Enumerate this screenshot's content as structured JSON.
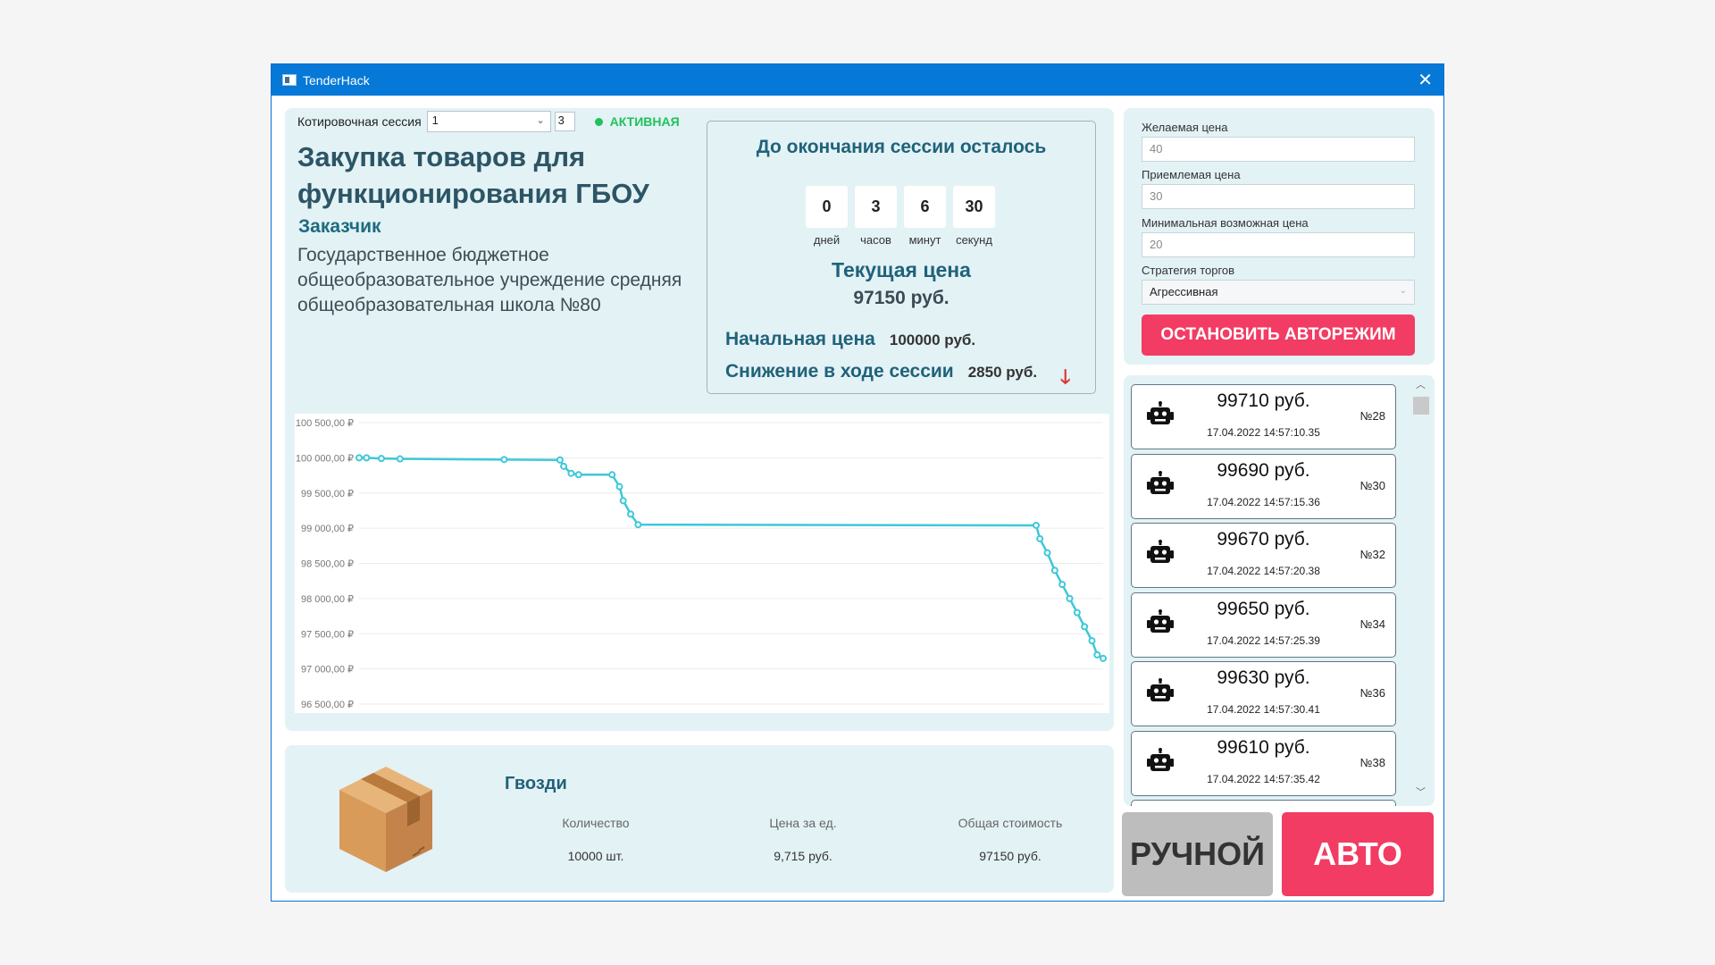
{
  "window": {
    "title": "TenderHack"
  },
  "session": {
    "label": "Котировочная сессия",
    "selected": "1",
    "number_field": "3",
    "status": "АКТИВНАЯ"
  },
  "purchase": {
    "title": "Закупка товаров для функционирования ГБОУ",
    "customer_label": "Заказчик",
    "customer_name": "Государственное бюджетное общеобразовательное учреждение средняя общеобразовательная школа №80"
  },
  "timer": {
    "title": "До окончания сессии осталось",
    "units": [
      {
        "value": "0",
        "label": "дней"
      },
      {
        "value": "3",
        "label": "часов"
      },
      {
        "value": "6",
        "label": "минут"
      },
      {
        "value": "30",
        "label": "секунд"
      }
    ],
    "current_price_label": "Текущая цена",
    "current_price": "97150 руб.",
    "start_price_label": "Начальная цена",
    "start_price": "100000 руб.",
    "decrease_label": "Снижение в ходе сессии",
    "decrease": "2850 руб."
  },
  "chart_data": {
    "type": "line",
    "y_ticks": [
      "100 500,00 ₽",
      "100 000,00 ₽",
      "99 500,00 ₽",
      "99 000,00 ₽",
      "98 500,00 ₽",
      "98 000,00 ₽",
      "97 500,00 ₽",
      "97 000,00 ₽",
      "96 500,00 ₽"
    ],
    "ylim": [
      96500,
      100500
    ],
    "xlim": [
      0,
      100
    ],
    "grid": true,
    "color": "#3ec8d8",
    "points": [
      {
        "x": 0,
        "y": 100000
      },
      {
        "x": 1,
        "y": 100000
      },
      {
        "x": 3,
        "y": 99990
      },
      {
        "x": 5.5,
        "y": 99985
      },
      {
        "x": 19.5,
        "y": 99975
      },
      {
        "x": 27,
        "y": 99970
      },
      {
        "x": 27.5,
        "y": 99880
      },
      {
        "x": 28.5,
        "y": 99780
      },
      {
        "x": 29.5,
        "y": 99760
      },
      {
        "x": 34,
        "y": 99760
      },
      {
        "x": 35,
        "y": 99590
      },
      {
        "x": 35.5,
        "y": 99390
      },
      {
        "x": 36.5,
        "y": 99200
      },
      {
        "x": 37.5,
        "y": 99050
      },
      {
        "x": 91,
        "y": 99040
      },
      {
        "x": 91.5,
        "y": 98850
      },
      {
        "x": 92.5,
        "y": 98650
      },
      {
        "x": 93.5,
        "y": 98400
      },
      {
        "x": 94.5,
        "y": 98200
      },
      {
        "x": 95.5,
        "y": 98000
      },
      {
        "x": 96.5,
        "y": 97800
      },
      {
        "x": 97.5,
        "y": 97600
      },
      {
        "x": 98.5,
        "y": 97400
      },
      {
        "x": 99.2,
        "y": 97200
      },
      {
        "x": 100,
        "y": 97150
      }
    ]
  },
  "product": {
    "name": "Гвозди",
    "columns": [
      {
        "header": "Количество",
        "value": "10000 шт."
      },
      {
        "header": "Цена за ед.",
        "value": "9,715 руб."
      },
      {
        "header": "Общая стоимость",
        "value": "97150 руб."
      }
    ]
  },
  "settings": {
    "desired_label": "Желаемая цена",
    "desired_value": "40",
    "acceptable_label": "Приемлемая цена",
    "acceptable_value": "30",
    "minimum_label": "Минимальная возможная цена",
    "minimum_value": "20",
    "strategy_label": "Стратегия торгов",
    "strategy_value": "Агрессивная",
    "stop_button": "ОСТАНОВИТЬ АВТОРЕЖИМ"
  },
  "bids": [
    {
      "price": "99710 руб.",
      "time": "17.04.2022 14:57:10.35",
      "no": "№28"
    },
    {
      "price": "99690 руб.",
      "time": "17.04.2022 14:57:15.36",
      "no": "№30"
    },
    {
      "price": "99670 руб.",
      "time": "17.04.2022 14:57:20.38",
      "no": "№32"
    },
    {
      "price": "99650 руб.",
      "time": "17.04.2022 14:57:25.39",
      "no": "№34"
    },
    {
      "price": "99630 руб.",
      "time": "17.04.2022 14:57:30.41",
      "no": "№36"
    },
    {
      "price": "99610 руб.",
      "time": "17.04.2022 14:57:35.42",
      "no": "№38"
    }
  ],
  "mode": {
    "manual": "РУЧНОЙ",
    "auto": "АВТО"
  },
  "icons": {
    "bid": "robot-icon",
    "product": "cardboard-box-icon",
    "decrease": "arrow-down-icon"
  },
  "colors": {
    "titlebar": "#0678d7",
    "accent": "#f23c63",
    "status": "#1fc25b",
    "chart_line": "#3ec8d8"
  }
}
